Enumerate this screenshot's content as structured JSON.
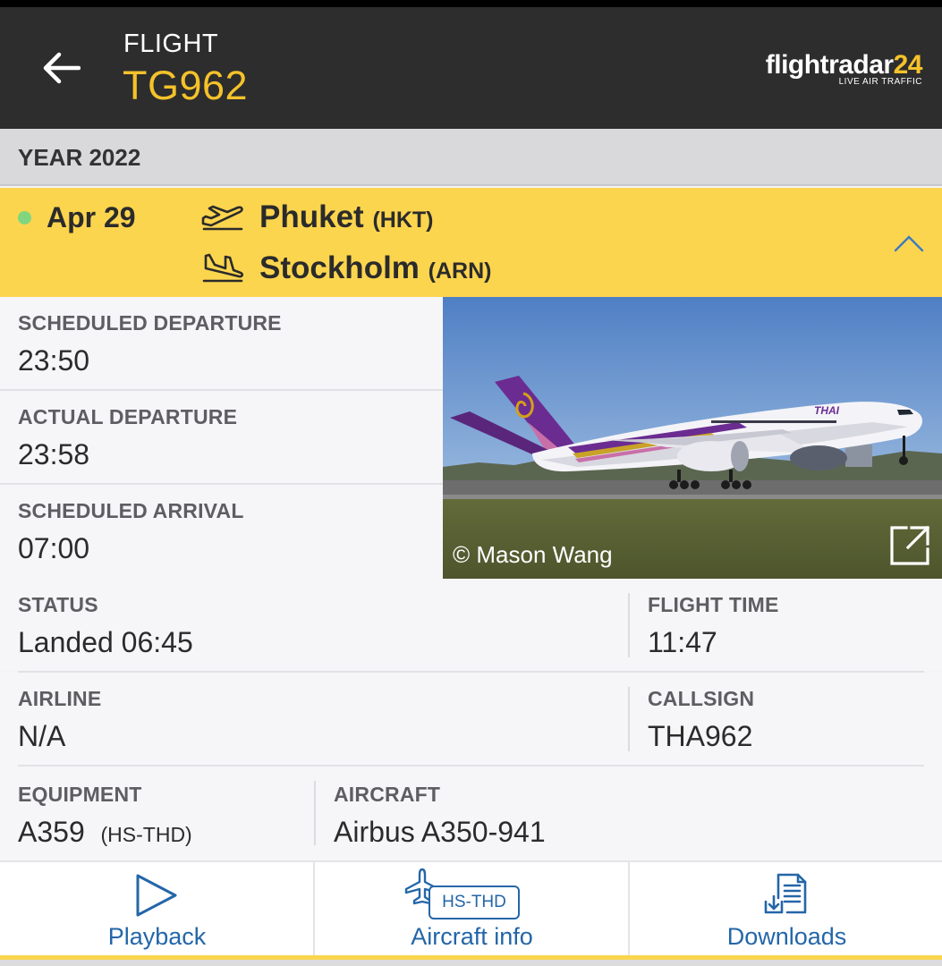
{
  "header": {
    "label": "FLIGHT",
    "flight_number": "TG962",
    "logo_text": "flightradar",
    "logo_number": "24",
    "logo_tagline": "LIVE AIR TRAFFIC"
  },
  "year_bar": {
    "text": "YEAR 2022"
  },
  "flight_row": {
    "date": "Apr 29",
    "departure": {
      "city": "Phuket",
      "code": "(HKT)"
    },
    "arrival": {
      "city": "Stockholm",
      "code": "(ARN)"
    }
  },
  "details": {
    "scheduled_departure": {
      "label": "SCHEDULED DEPARTURE",
      "value": "23:50"
    },
    "actual_departure": {
      "label": "ACTUAL DEPARTURE",
      "value": "23:58"
    },
    "scheduled_arrival": {
      "label": "SCHEDULED ARRIVAL",
      "value": "07:00"
    },
    "status": {
      "label": "STATUS",
      "value": "Landed 06:45"
    },
    "flight_time": {
      "label": "FLIGHT TIME",
      "value": "11:47"
    },
    "airline": {
      "label": "AIRLINE",
      "value": "N/A"
    },
    "callsign": {
      "label": "CALLSIGN",
      "value": "THA962"
    },
    "equipment": {
      "label": "EQUIPMENT",
      "value": "A359",
      "registration": "(HS-THD)"
    },
    "aircraft": {
      "label": "AIRCRAFT",
      "value": "Airbus A350-941"
    }
  },
  "photo": {
    "credit": "© Mason Wang",
    "livery_text": "THAI"
  },
  "actions": {
    "playback": "Playback",
    "aircraft_info": "Aircraft info",
    "aircraft_badge": "HS-THD",
    "downloads": "Downloads"
  },
  "colors": {
    "header_bg": "#2d2d2d",
    "accent_yellow": "#f5c22a",
    "flight_row_bg": "#fcd54e",
    "link_blue": "#2466a8",
    "live_dot": "#7fd67f"
  },
  "icons": [
    "arrow-left-icon",
    "takeoff-icon",
    "landing-icon",
    "chevron-up-icon",
    "expand-icon",
    "play-icon",
    "aircraft-icon",
    "download-icon"
  ]
}
